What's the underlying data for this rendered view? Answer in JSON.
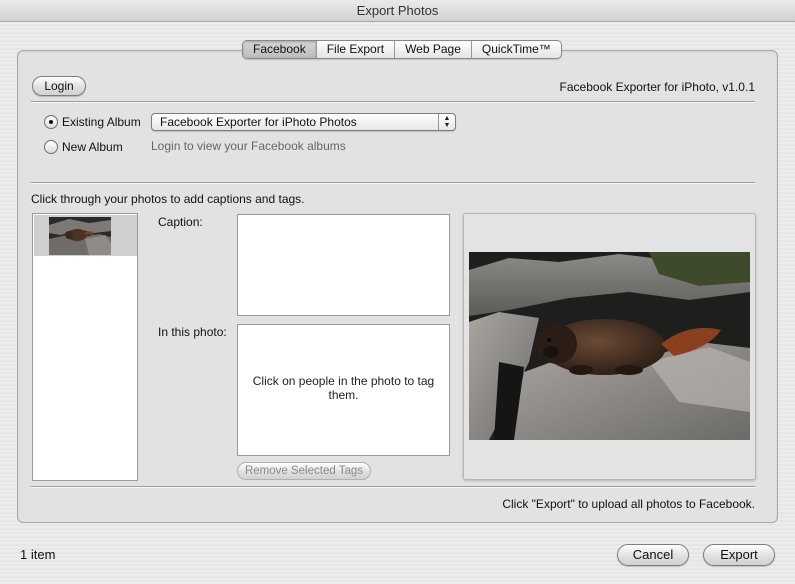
{
  "window": {
    "title": "Export Photos"
  },
  "tabs": [
    {
      "label": "Facebook",
      "selected": true
    },
    {
      "label": "File Export",
      "selected": false
    },
    {
      "label": "Web Page",
      "selected": false
    },
    {
      "label": "QuickTime™",
      "selected": false
    }
  ],
  "header": {
    "login_label": "Login",
    "exporter_version": "Facebook Exporter for iPhoto, v1.0.1"
  },
  "album": {
    "existing_label": "Existing Album",
    "new_label": "New Album",
    "selected_option": "existing",
    "select_value": "Facebook Exporter for iPhoto Photos",
    "login_hint": "Login to view your Facebook albums"
  },
  "photos": {
    "instructions": "Click through your photos to add captions and tags.",
    "caption_label": "Caption:",
    "caption_value": "",
    "tags_label": "In this photo:",
    "tags_hint": "Click on people in the photo to tag them.",
    "remove_tags_label": "Remove Selected Tags",
    "preview_subject": "marmot-on-rocks"
  },
  "footer": {
    "export_hint": "Click \"Export\" to upload all photos to Facebook.",
    "item_count": "1 item",
    "cancel_label": "Cancel",
    "export_label": "Export"
  },
  "colors": {
    "window_bg": "#ececec",
    "panel_bg": "#e2e2e2",
    "thumb_selection": "#cfcfcf"
  }
}
